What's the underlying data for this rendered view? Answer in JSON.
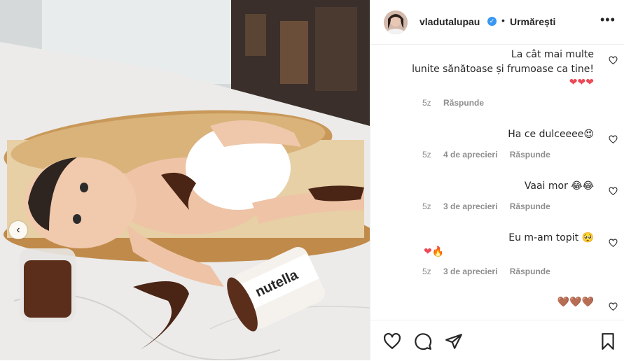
{
  "post": {
    "username": "vladutalupau",
    "verified_icon": "verified-badge-icon",
    "separator": "•",
    "follow_label": "Urmărești",
    "more_icon": "more-options-icon"
  },
  "comments": [
    {
      "line1": "La cât mai multe",
      "line2": "lunite sănătoase și frumoase ca tine!",
      "emoji": "❤❤❤",
      "time": "5z",
      "likes": "",
      "reply": "Răspunde"
    },
    {
      "line1": "Ha ce dulceeee😍",
      "time": "5z",
      "likes": "4 de aprecieri",
      "reply": "Răspunde"
    },
    {
      "line1": "Vaai mor 😂😂",
      "time": "5z",
      "likes": "3 de aprecieri",
      "reply": "Răspunde"
    },
    {
      "line1": "Eu m-am topit 🥺",
      "emoji": "❤🔥",
      "time": "5z",
      "likes": "3 de aprecieri",
      "reply": "Răspunde"
    },
    {
      "line1": "🤎🤎🤎"
    }
  ],
  "photo": {
    "jar_label": "nutella"
  },
  "icons": {
    "like": "heart-icon",
    "comment": "comment-icon",
    "share": "share-icon",
    "save": "bookmark-icon",
    "prev": "chevron-left-icon"
  },
  "colors": {
    "heart_red": "#ed4956",
    "verified_blue": "#3897f0",
    "meta_gray": "#8e8e8e"
  }
}
